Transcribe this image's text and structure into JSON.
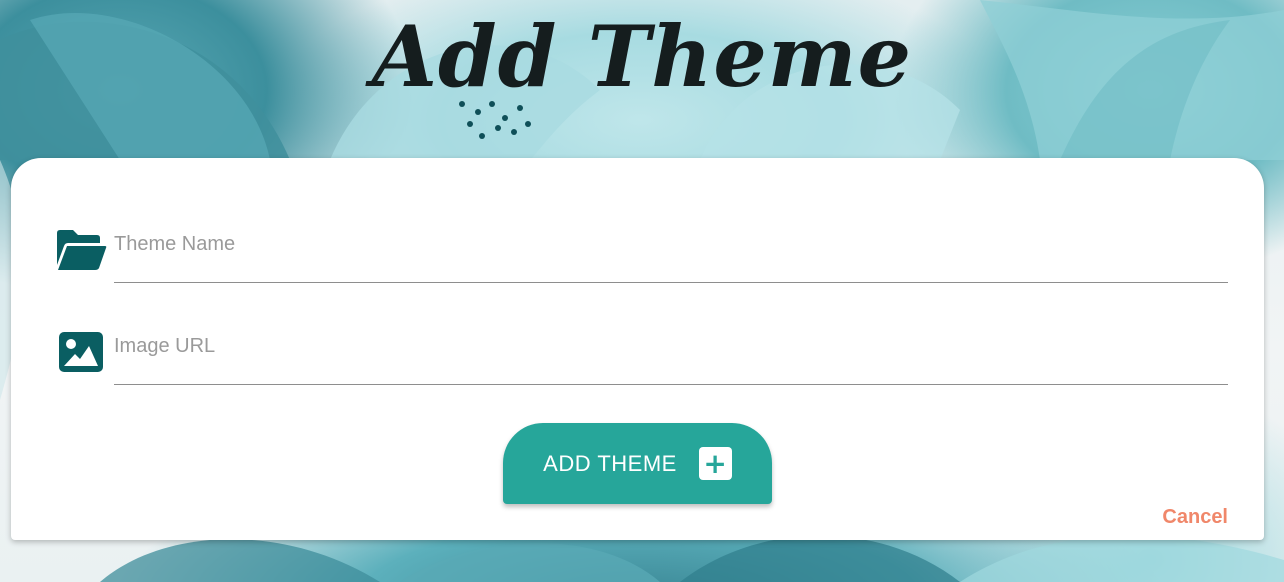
{
  "header": {
    "title": "Add Theme"
  },
  "form": {
    "theme_name": {
      "icon": "folder-open-icon",
      "value": "",
      "placeholder": "Theme Name"
    },
    "image_url": {
      "icon": "image-icon",
      "value": "",
      "placeholder": "Image URL"
    },
    "submit": {
      "label": "ADD THEME",
      "icon": "plus-box-icon"
    },
    "cancel_label": "Cancel"
  },
  "colors": {
    "accent": "#26a69a",
    "icon": "#0a5e62",
    "cancel": "#f0876a",
    "title": "#151d1e"
  }
}
